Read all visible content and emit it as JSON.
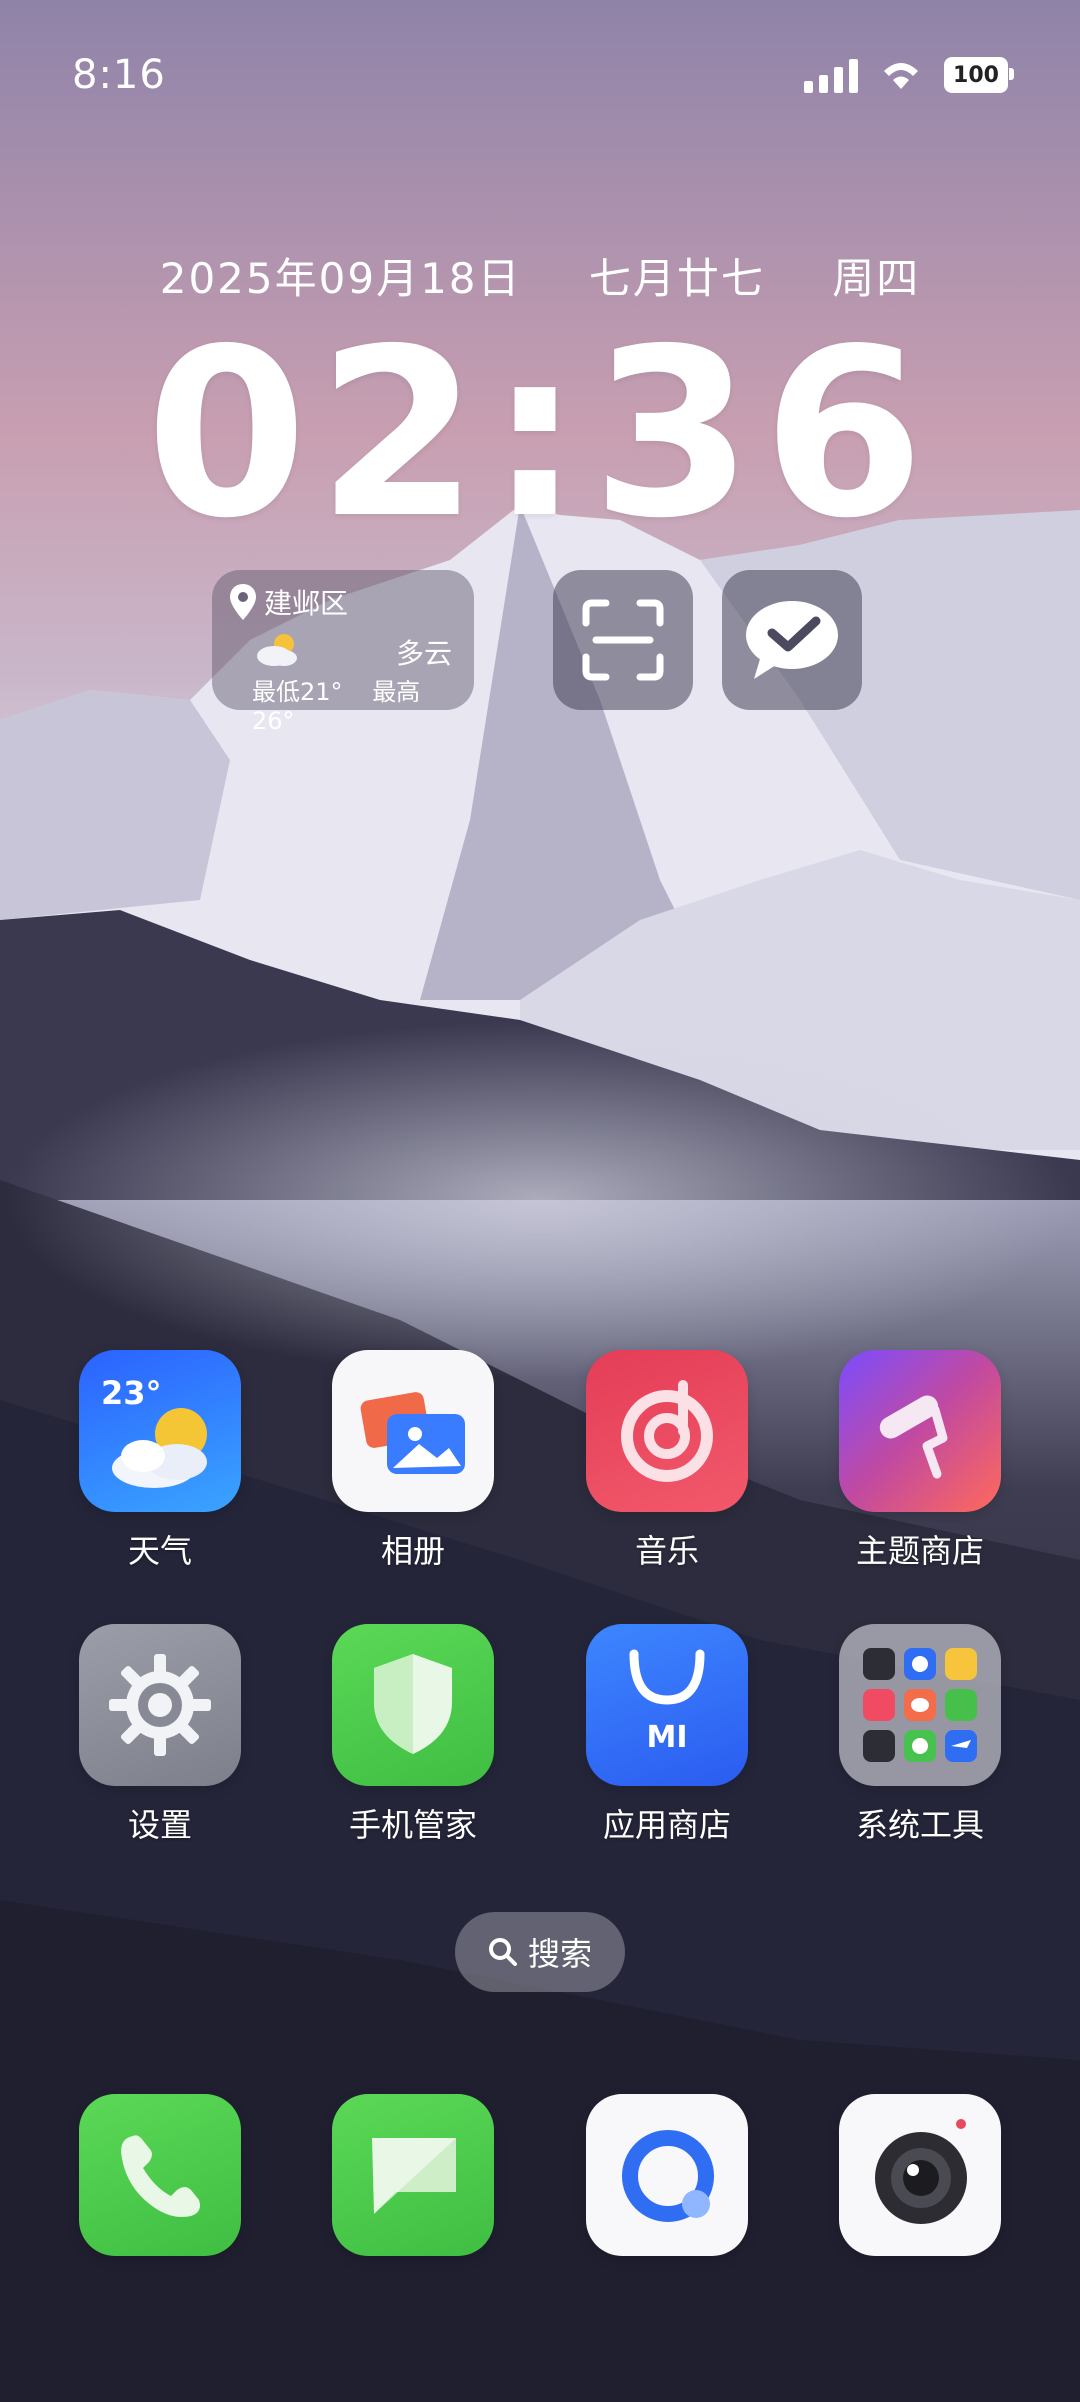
{
  "status_bar": {
    "time": "8:16",
    "battery": "100"
  },
  "lockscreen": {
    "date": "2025年09月18日",
    "lunar": "七月廿七",
    "weekday": "周四",
    "clock": "02:36"
  },
  "weather_widget": {
    "location": "建邺区",
    "condition": "多云",
    "low": "最低21°",
    "high": "最高 26°"
  },
  "apps_row1": [
    {
      "label": "天气",
      "temp": "23°"
    },
    {
      "label": "相册"
    },
    {
      "label": "音乐"
    },
    {
      "label": "主题商店"
    }
  ],
  "apps_row2": [
    {
      "label": "设置"
    },
    {
      "label": "手机管家"
    },
    {
      "label": "应用商店",
      "logo": "MI"
    },
    {
      "label": "系统工具"
    }
  ],
  "search": {
    "label": "搜索"
  },
  "colors": {
    "weather": "#2f7bff",
    "music": "#e8455a",
    "theme_start": "#8a4dff",
    "theme_end": "#ff6a5a",
    "security": "#4ec94a",
    "appstore": "#2c63ff",
    "phone": "#4bd04a"
  }
}
